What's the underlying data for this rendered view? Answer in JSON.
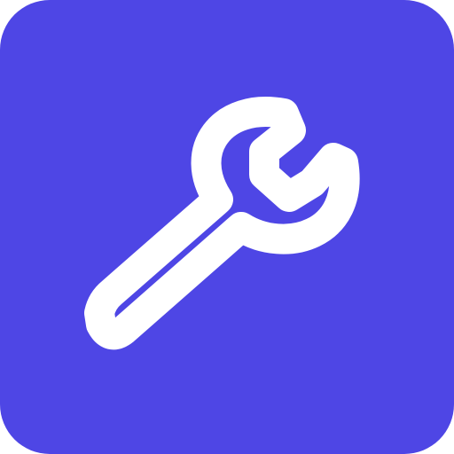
{
  "app_icon": {
    "icon": "wrench-icon",
    "background_color": "#4e46e5",
    "glyph_color": "#ffffff"
  }
}
